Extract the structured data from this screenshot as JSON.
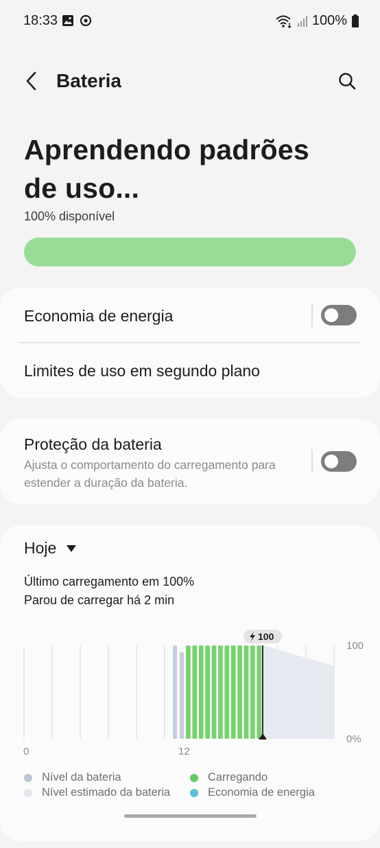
{
  "status_bar": {
    "time": "18:33",
    "left_icons": [
      "image-icon",
      "data-saver-icon"
    ],
    "right_icons": [
      "wifi-icon",
      "signal-icon",
      "battery-icon"
    ],
    "battery_text": "100%"
  },
  "app_bar": {
    "title": "Bateria",
    "back_icon": "back-arrow-icon",
    "search_icon": "search-icon"
  },
  "hero": {
    "title": "Aprendendo padrões de uso...",
    "subtitle": "100% disponível",
    "battery_level": 1.0
  },
  "settings_group_1": {
    "power_saving_label": "Economia de energia",
    "power_saving_on": false,
    "background_limits_label": "Limites de uso em segundo plano"
  },
  "settings_group_2": {
    "protection_label": "Proteção da bateria",
    "protection_desc": "Ajusta o comportamento do carregamento para estender a duração da bateria.",
    "protection_on": false
  },
  "usage": {
    "period": "Hoje",
    "last_charge": "Último carregamento em 100%",
    "stopped": "Parou de carregar há 2 min"
  },
  "chart_data": {
    "type": "bar",
    "title": "",
    "x_ticks": [
      "0",
      "12"
    ],
    "y_ticks": [
      "100",
      "0%"
    ],
    "ylim": [
      0,
      100
    ],
    "marker_label": "100",
    "series": [
      {
        "name": "Nível da bateria",
        "color": "#c3cedc",
        "values": [
          100,
          98
        ]
      },
      {
        "name": "Carregando",
        "color": "#78d36e",
        "values": [
          100,
          100,
          100,
          100,
          100,
          100,
          100,
          100,
          100,
          100,
          100,
          100
        ]
      },
      {
        "name": "Nível estimado da bateria",
        "color": "#e6e9f0",
        "start": 100,
        "end": 78
      },
      {
        "name": "Economia de energia",
        "color": "#5bc3d6",
        "values": []
      }
    ]
  },
  "legend": [
    {
      "label": "Nível da bateria",
      "color": "#bcc7d6"
    },
    {
      "label": "Carregando",
      "color": "#66c966"
    },
    {
      "label": "Nível estimado da bateria",
      "color": "#e3e6ee"
    },
    {
      "label": "Economia de energia",
      "color": "#5bc3d6"
    }
  ]
}
